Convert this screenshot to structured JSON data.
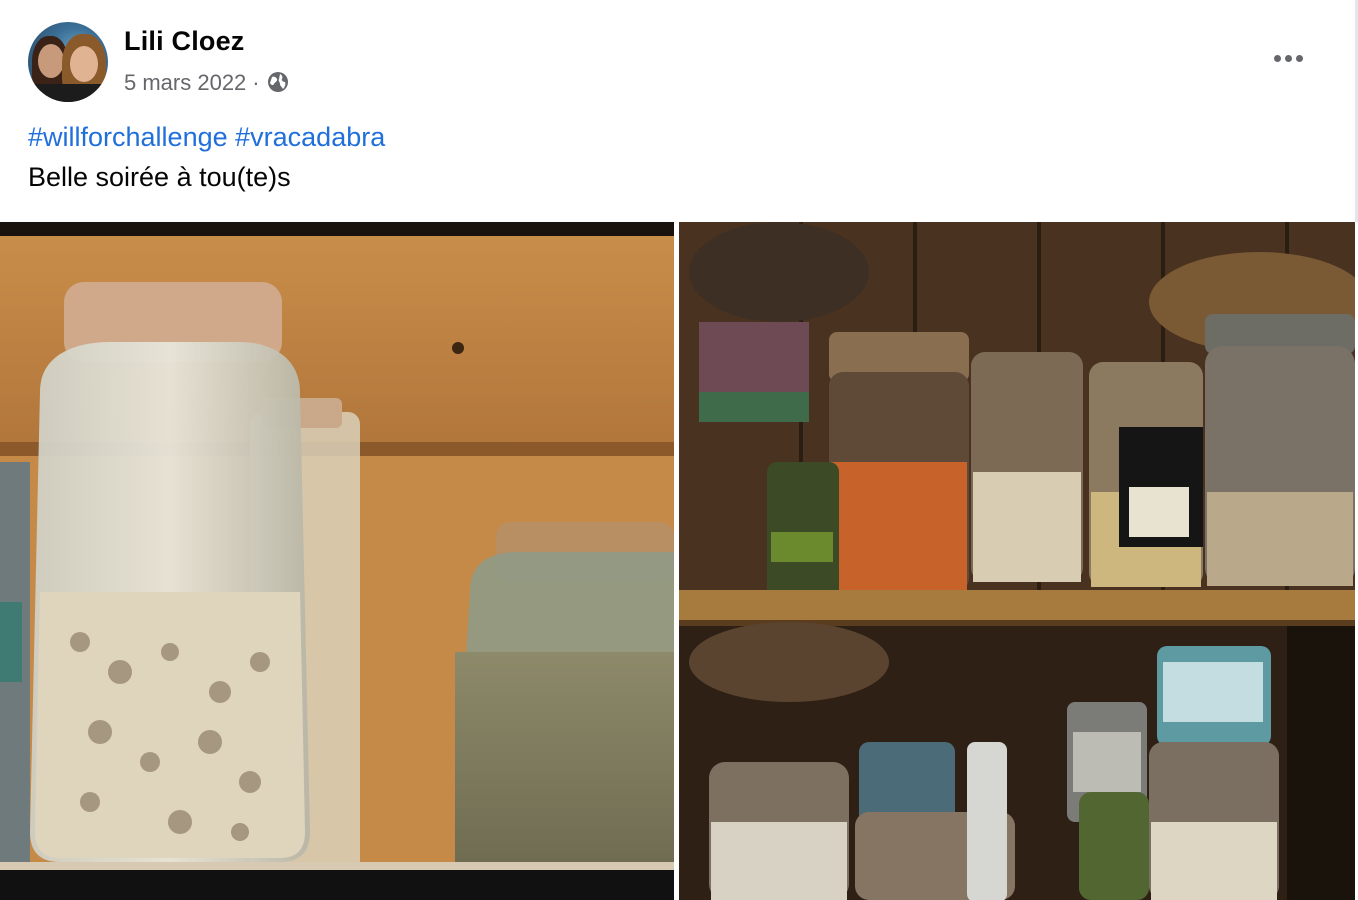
{
  "post": {
    "author": "Lili Cloez",
    "date": "5 mars 2022",
    "separator": "·",
    "privacy_icon": "globe-icon",
    "more_icon": "more-options-icon",
    "hashtags": [
      "#willforchallenge",
      "#vracadabra"
    ],
    "text": "Belle soirée à tou(te)s"
  },
  "photos": [
    {
      "description_icon": "photo-jars-closeup"
    },
    {
      "description_icon": "photo-pantry-shelves"
    }
  ],
  "colors": {
    "link": "#216fdb",
    "secondary_text": "#65676b"
  }
}
